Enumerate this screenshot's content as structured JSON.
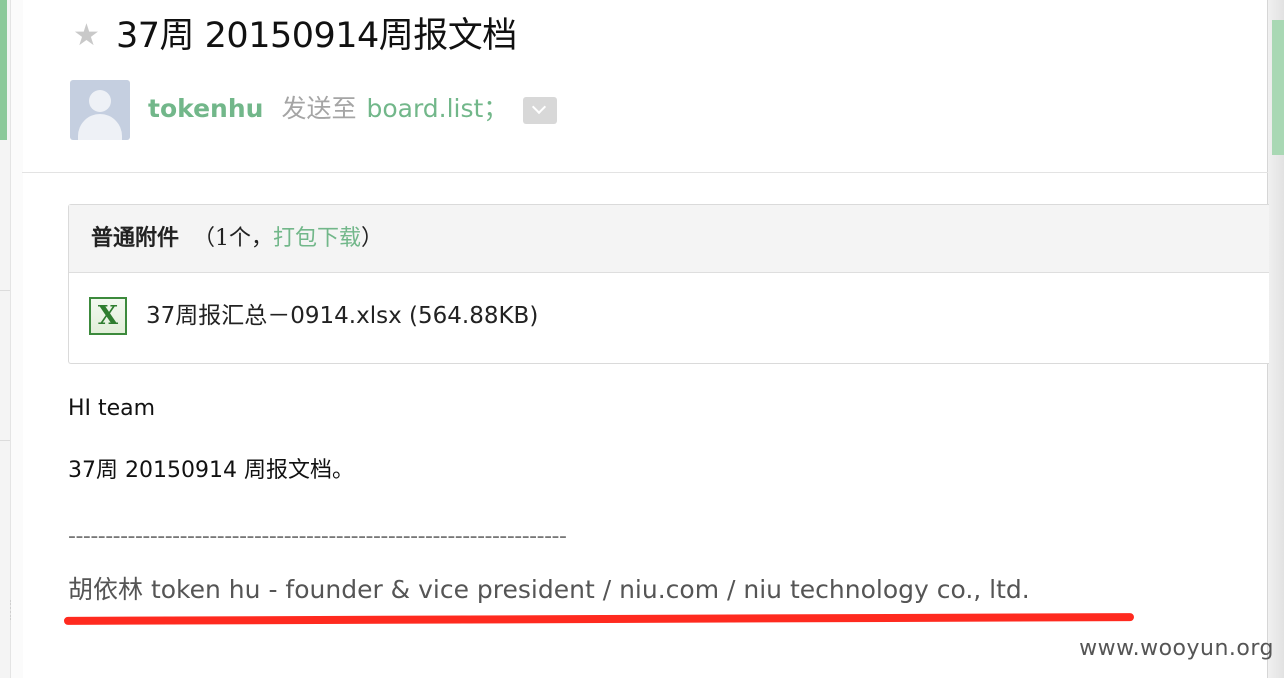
{
  "email": {
    "subject": "37周 20150914周报文档",
    "sender": "tokenhu",
    "sent_to_label": "发送至",
    "recipients": "board.list；"
  },
  "attachments": {
    "title": "普通附件",
    "count_open": "（1个，",
    "download_label": "打包下载",
    "count_close": "）",
    "items": [
      {
        "filename": "37周报汇总－0914.xlsx (564.88KB)",
        "icon": "excel-file-icon",
        "icon_glyph": "X"
      }
    ]
  },
  "body": {
    "greeting": "HI team",
    "line2": "37周 20150914 周报文档。",
    "separator": "-------------------------------------------------------------------",
    "signature": "胡依林 token hu  - founder & vice president /  niu.com / niu technology co., ltd."
  },
  "watermark": "www.wooyun.org",
  "colors": {
    "accent_green": "#72b78a",
    "highlight_underline": "#ff2a1f"
  }
}
